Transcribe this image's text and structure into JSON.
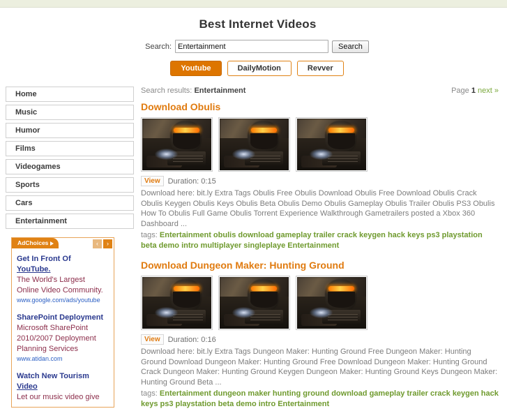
{
  "header": {
    "title": "Best Internet Videos",
    "search_label": "Search:",
    "search_value": "Entertainment",
    "search_placeholder": "",
    "search_button": "Search",
    "tabs": [
      {
        "label": "Youtube",
        "active": true
      },
      {
        "label": "DailyMotion",
        "active": false
      },
      {
        "label": "Revver",
        "active": false
      }
    ]
  },
  "sidebar": {
    "items": [
      {
        "label": "Home"
      },
      {
        "label": "Music"
      },
      {
        "label": "Humor"
      },
      {
        "label": "Films"
      },
      {
        "label": "Videogames"
      },
      {
        "label": "Sports"
      },
      {
        "label": "Cars"
      },
      {
        "label": "Entertainment"
      }
    ],
    "ad_box": {
      "adchoices_label": "AdChoices",
      "prev_arrow": "‹",
      "next_arrow": "›",
      "ads": [
        {
          "title_line1": "Get In Front Of",
          "title_link": "YouTube.",
          "desc": "The World's Largest Online Video Community.",
          "url": "www.google.com/ads/youtube"
        },
        {
          "title_line1": "SharePoint Deployment",
          "title_link": "",
          "desc": "Microsoft SharePoint 2010/2007 Deployment Planning Services",
          "url": "www.atidan.com"
        },
        {
          "title_line1": "Watch New Tourism",
          "title_link": "Video",
          "desc": "Let our music video give",
          "url": ""
        }
      ]
    }
  },
  "results_bar": {
    "label": "Search results:",
    "query": "Entertainment",
    "page_label": "Page",
    "page_number": "1",
    "next_label": "next »"
  },
  "results": [
    {
      "title": "Download Obulis",
      "view_label": "View",
      "duration_label": "Duration: 0:15",
      "description": "Download here: bit.ly Extra Tags Obulis Free Obulis Download Obulis Free Download Obulis Crack Obulis Keygen Obulis Keys Obulis Beta Obulis Demo Obulis Gameplay Obulis Trailer Obulis PS3 Obulis How To Obulis Full Game Obulis Torrent Experience Walkthrough Gametrailers posted a Xbox 360 Dashboard ...",
      "tags_label": "tags:",
      "tags": "Entertainment obulis download gameplay trailer crack keygen hack keys ps3 playstation beta demo intro multiplayer singleplaye Entertainment",
      "thumb_count": 3
    },
    {
      "title": "Download Dungeon Maker: Hunting Ground",
      "view_label": "View",
      "duration_label": "Duration: 0:16",
      "description": "Download here: bit.ly Extra Tags Dungeon Maker: Hunting Ground Free Dungeon Maker: Hunting Ground Download Dungeon Maker: Hunting Ground Free Download Dungeon Maker: Hunting Ground Crack Dungeon Maker: Hunting Ground Keygen Dungeon Maker: Hunting Ground Keys Dungeon Maker: Hunting Ground Beta ...",
      "tags_label": "tags:",
      "tags": "Entertainment dungeon maker hunting ground download gameplay trailer crack keygen hack keys ps3 playstation beta demo intro Entertainment",
      "thumb_count": 3
    }
  ],
  "colors": {
    "accent_orange": "#dd7500",
    "title_orange": "#e07b10",
    "tag_green": "#6f9a2e",
    "top_strip": "#ecefdf"
  }
}
